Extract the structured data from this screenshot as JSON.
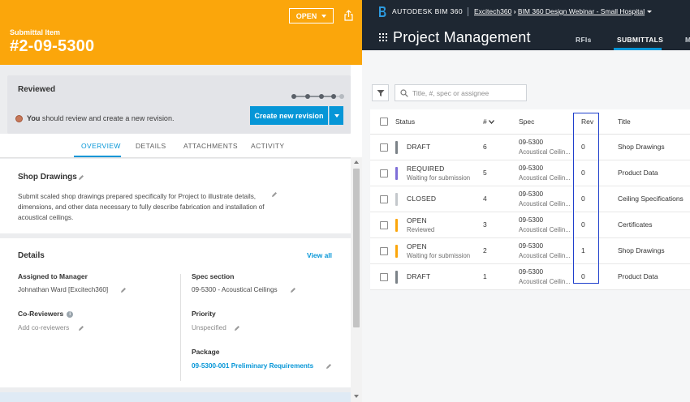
{
  "submittal": {
    "header_label": "Submittal Item",
    "number": "#2-09-5300",
    "status_dropdown": "OPEN",
    "card": {
      "state": "Reviewed",
      "note_bold": "You",
      "note_rest": "should review and create a new revision.",
      "primary_button": "Create new revision"
    },
    "tabs": [
      {
        "label": "OVERVIEW"
      },
      {
        "label": "DETAILS"
      },
      {
        "label": "ATTACHMENTS"
      },
      {
        "label": "ACTIVITY"
      }
    ],
    "type_title": "Shop Drawings",
    "description": "Submit scaled shop drawings prepared specifically for Project to illustrate details, dimensions, and other data necessary to fully describe fabrication and installation of acoustical ceilings.",
    "details": {
      "title": "Details",
      "view_all": "View all",
      "assigned_label": "Assigned to Manager",
      "assigned_value": "Johnathan Ward [Excitech360]",
      "coreviewers_label": "Co-Reviewers",
      "coreviewers_value": "Add co-reviewers",
      "spec_label": "Spec section",
      "spec_value": "09-5300 - Acoustical Ceilings",
      "priority_label": "Priority",
      "priority_value": "Unspecified",
      "package_label": "Package",
      "package_value": "09-5300-001 Preliminary Requirements"
    }
  },
  "bim": {
    "brand_autodesk": "AUTODESK",
    "brand_product": "BIM 360",
    "breadcrumb_account": "Excitech360",
    "breadcrumb_sep": "›",
    "breadcrumb_project": "BIM 360 Design Webinar - Small Hospital",
    "module_title": "Project Management",
    "nav": [
      {
        "label": "RFIs"
      },
      {
        "label": "SUBMITTALS"
      },
      {
        "label": "M"
      }
    ],
    "search_placeholder": "Title, #, spec or assignee",
    "columns": {
      "status": "Status",
      "num": "#",
      "spec": "Spec",
      "rev": "Rev",
      "title": "Title"
    },
    "rows": [
      {
        "status": "DRAFT",
        "substatus": "",
        "num": "6",
        "spec": "09-5300",
        "spec_name": "Acoustical Ceilin...",
        "rev": "0",
        "title": "Shop Drawings",
        "color": "#7b8288"
      },
      {
        "status": "REQUIRED",
        "substatus": "Waiting for submission",
        "num": "5",
        "spec": "09-5300",
        "spec_name": "Acoustical Ceilin...",
        "rev": "0",
        "title": "Product Data",
        "color": "#7f6fd8"
      },
      {
        "status": "CLOSED",
        "substatus": "",
        "num": "4",
        "spec": "09-5300",
        "spec_name": "Acoustical Ceilin...",
        "rev": "0",
        "title": "Ceiling Specifications",
        "color": "#c4c8cc"
      },
      {
        "status": "OPEN",
        "substatus": "Reviewed",
        "num": "3",
        "spec": "09-5300",
        "spec_name": "Acoustical Ceilin...",
        "rev": "0",
        "title": "Certificates",
        "color": "#fba60b"
      },
      {
        "status": "OPEN",
        "substatus": "Waiting for submission",
        "num": "2",
        "spec": "09-5300",
        "spec_name": "Acoustical Ceilin...",
        "rev": "1",
        "title": "Shop Drawings",
        "color": "#fba60b"
      },
      {
        "status": "DRAFT",
        "substatus": "",
        "num": "1",
        "spec": "09-5300",
        "spec_name": "Acoustical Ceilin...",
        "rev": "0",
        "title": "Product Data",
        "color": "#7b8288"
      }
    ]
  },
  "colors": {
    "header_orange": "#fba60b",
    "primary_blue": "#0696d7",
    "topbar_dark": "#1e2732",
    "annotation_box": "#1f3fcc"
  }
}
